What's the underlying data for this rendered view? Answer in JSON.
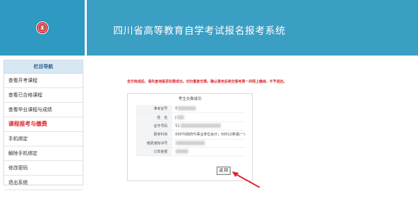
{
  "header": {
    "title": "四川省高等教育自学考试报名报考系统",
    "brand_color": "#3b9fc4"
  },
  "sidebar": {
    "heading": "栏目导航",
    "items": [
      {
        "label": "查看开考课程"
      },
      {
        "label": "查看已合格课程"
      },
      {
        "label": "查看毕业课程与成绩"
      },
      {
        "label": "课程报考与缴费",
        "active": true
      },
      {
        "label": "手机绑定"
      },
      {
        "label": "解除手机绑定"
      },
      {
        "label": "修改密码"
      },
      {
        "label": "退出系统"
      }
    ]
  },
  "main": {
    "notice": "支付完成后，请先查询是否扣费成功，切勿重复交费。确认报考后将交报考费一并网上缴纳，不予退还。",
    "panel_title": "考生交费成功",
    "rows": [
      {
        "label": "准考证号",
        "value": "0"
      },
      {
        "label": "姓　名",
        "value": "J"
      },
      {
        "label": "证件号码",
        "value": "51"
      },
      {
        "label": "报考科目",
        "value": "00070政府与事业单位会计；00012英语(一)"
      },
      {
        "label": "缴费通知书号",
        "value": ""
      },
      {
        "label": "订单金额",
        "value": ""
      }
    ],
    "return_label": "返 回",
    "accent_color": "#d9262c"
  }
}
